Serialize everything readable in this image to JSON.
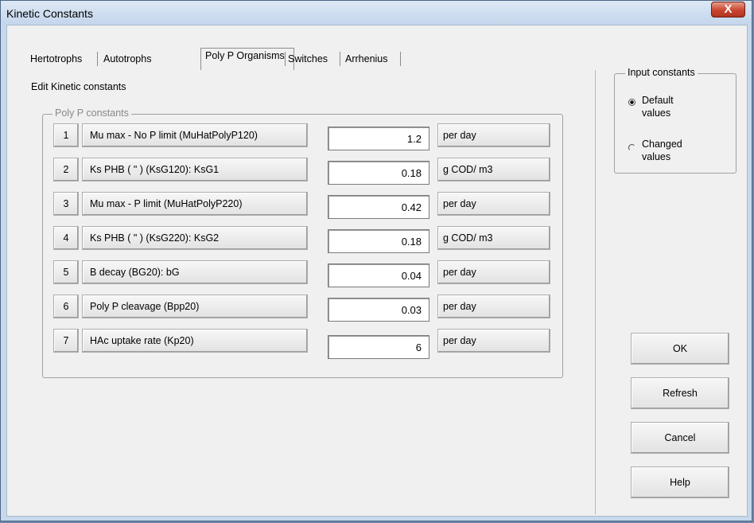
{
  "window": {
    "title": "Kinetic Constants",
    "close_label": "X"
  },
  "tabs": [
    {
      "label": "Hertotrophs",
      "active": false
    },
    {
      "label": "Autotrophs",
      "active": false
    },
    {
      "label": "Poly P Organisms",
      "active": true
    },
    {
      "label": "Switches",
      "active": false
    },
    {
      "label": "Arrhenius",
      "active": false
    }
  ],
  "panel": {
    "heading": "Edit Kinetic constants",
    "group_title": "Poly P constants"
  },
  "rows": [
    {
      "num": "1",
      "label": "Mu max - No P limit (MuHatPolyP120)",
      "value": "1.2",
      "unit": "per day"
    },
    {
      "num": "2",
      "label": "Ks PHB ( \" ) (KsG120): KsG1",
      "value": "0.18",
      "unit": "g COD/ m3"
    },
    {
      "num": "3",
      "label": "Mu max - P limit (MuHatPolyP220)",
      "value": "0.42",
      "unit": "per day"
    },
    {
      "num": "4",
      "label": "Ks PHB ( \" ) (KsG220): KsG2",
      "value": "0.18",
      "unit": "g COD/ m3"
    },
    {
      "num": "5",
      "label": "B decay (BG20): bG",
      "value": "0.04",
      "unit": "per day"
    },
    {
      "num": "6",
      "label": "Poly P cleavage (Bpp20)",
      "value": "0.03",
      "unit": "per day"
    },
    {
      "num": "7",
      "label": "HAc uptake rate (Kp20)",
      "value": "6",
      "unit": "per day"
    }
  ],
  "input_constants": {
    "title": "Input constants",
    "options": [
      {
        "label": "Default values",
        "selected": true
      },
      {
        "label": "Changed values",
        "selected": false
      }
    ]
  },
  "buttons": {
    "ok": "OK",
    "refresh": "Refresh",
    "cancel": "Cancel",
    "help": "Help"
  }
}
